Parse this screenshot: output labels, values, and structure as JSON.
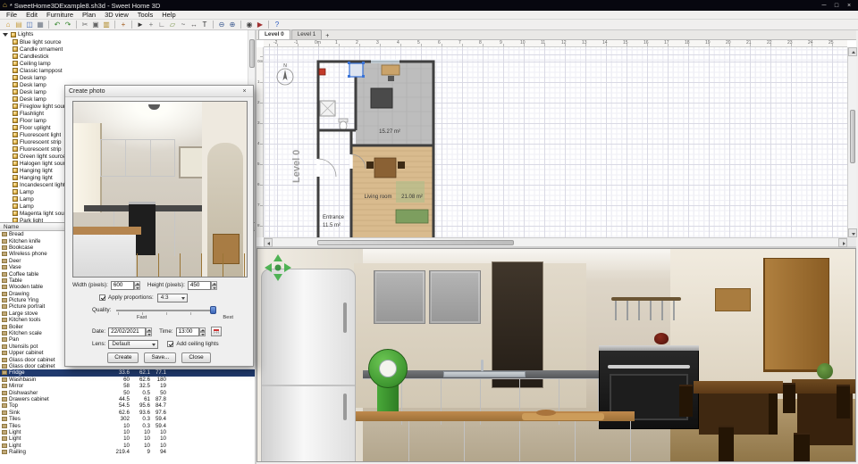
{
  "window": {
    "title": "* SweetHome3DExample8.sh3d - Sweet Home 3D",
    "app_icon": "⌂",
    "controls": {
      "minimize": "─",
      "maximize": "□",
      "close": "×"
    }
  },
  "menu": {
    "items": [
      "File",
      "Edit",
      "Furniture",
      "Plan",
      "3D view",
      "Tools",
      "Help"
    ]
  },
  "toolbar": {
    "buttons": [
      {
        "name": "new-home-icon",
        "glyph": "⌂",
        "color": "#c8912a"
      },
      {
        "name": "open-icon",
        "glyph": "▤",
        "color": "#c8a24a"
      },
      {
        "name": "save-icon",
        "glyph": "◫",
        "color": "#3c66b0"
      },
      {
        "name": "print-icon",
        "glyph": "▦",
        "color": "#6d7683"
      },
      {
        "sep": true
      },
      {
        "name": "undo-icon",
        "glyph": "↶",
        "color": "#3c8a34"
      },
      {
        "name": "redo-icon",
        "glyph": "↷",
        "color": "#3c8a34"
      },
      {
        "sep": true
      },
      {
        "name": "cut-icon",
        "glyph": "✂",
        "color": "#666"
      },
      {
        "name": "copy-icon",
        "glyph": "▣",
        "color": "#666"
      },
      {
        "name": "paste-icon",
        "glyph": "▥",
        "color": "#b08a28"
      },
      {
        "sep": true
      },
      {
        "name": "add-furniture-icon",
        "glyph": "+",
        "color": "#a05a1a"
      },
      {
        "sep": true
      },
      {
        "name": "select-icon",
        "glyph": "►",
        "color": "#333"
      },
      {
        "name": "pan-icon",
        "glyph": "+",
        "color": "#777"
      },
      {
        "name": "create-walls-icon",
        "glyph": "∟",
        "color": "#555"
      },
      {
        "name": "create-rooms-icon",
        "glyph": "▱",
        "color": "#6d8c3c"
      },
      {
        "name": "create-polylines-icon",
        "glyph": "~",
        "color": "#555"
      },
      {
        "name": "create-dimensions-icon",
        "glyph": "↔",
        "color": "#555"
      },
      {
        "name": "add-text-icon",
        "glyph": "T",
        "color": "#333"
      },
      {
        "sep": true
      },
      {
        "name": "zoom-out-icon",
        "glyph": "⊖",
        "color": "#3c5a90"
      },
      {
        "name": "zoom-in-icon",
        "glyph": "⊕",
        "color": "#3c5a90"
      },
      {
        "sep": true
      },
      {
        "name": "photo-icon",
        "glyph": "◉",
        "color": "#444"
      },
      {
        "name": "video-icon",
        "glyph": "▶",
        "color": "#a03030"
      },
      {
        "sep": true
      },
      {
        "name": "help-icon",
        "glyph": "?",
        "color": "#2a5ac0"
      }
    ]
  },
  "catalog": {
    "category": "Lights",
    "items": [
      "Blue light source",
      "Candle ornament",
      "Candlestick",
      "Ceiling lamp",
      "Classic lamppost",
      "Desk lamp",
      "Desk lamp",
      "Desk lamp",
      "Desk lamp",
      "Fireglow light sour",
      "Flashlight",
      "Floor lamp",
      "Floor uplight",
      "Fluorescent light",
      "Fluorescent strip",
      "Fluorescent strip",
      "Green light source",
      "Halogen light sour",
      "Hanging light",
      "Hanging light",
      "Incandescent light",
      "Lamp",
      "Lamp",
      "Lamp",
      "Magenta light sou",
      "Park light"
    ]
  },
  "furniture_list": {
    "header": "Name",
    "rows": [
      {
        "name": "Bread",
        "v1": "",
        "v2": "",
        "v3": ""
      },
      {
        "name": "Kitchen knife",
        "v1": "",
        "v2": "",
        "v3": ""
      },
      {
        "name": "Bookcase",
        "v1": "",
        "v2": "",
        "v3": ""
      },
      {
        "name": "Wireless phone",
        "v1": "",
        "v2": "",
        "v3": ""
      },
      {
        "name": "Deer",
        "v1": "",
        "v2": "",
        "v3": ""
      },
      {
        "name": "Vase",
        "v1": "",
        "v2": "",
        "v3": ""
      },
      {
        "name": "Coffee table",
        "v1": "",
        "v2": "",
        "v3": ""
      },
      {
        "name": "Table",
        "v1": "",
        "v2": "",
        "v3": ""
      },
      {
        "name": "Wooden table",
        "v1": "",
        "v2": "",
        "v3": ""
      },
      {
        "name": "Drawing",
        "v1": "",
        "v2": "",
        "v3": ""
      },
      {
        "name": "Picture Ying",
        "v1": "",
        "v2": "",
        "v3": ""
      },
      {
        "name": "Picture portrait",
        "v1": "",
        "v2": "",
        "v3": ""
      },
      {
        "name": "Large stove",
        "v1": "",
        "v2": "",
        "v3": ""
      },
      {
        "name": "Kitchen tools",
        "v1": "",
        "v2": "",
        "v3": ""
      },
      {
        "name": "Boiler",
        "v1": "",
        "v2": "",
        "v3": ""
      },
      {
        "name": "Kitchen scale",
        "v1": "",
        "v2": "",
        "v3": ""
      },
      {
        "name": "Pan",
        "v1": "",
        "v2": "",
        "v3": ""
      },
      {
        "name": "Utensils pot",
        "v1": "",
        "v2": "",
        "v3": ""
      },
      {
        "name": "Upper cabinet",
        "v1": "",
        "v2": "",
        "v3": ""
      },
      {
        "name": "Glass door cabinet",
        "v1": "",
        "v2": "",
        "v3": ""
      },
      {
        "name": "Glass door cabinet",
        "v1": "",
        "v2": "",
        "v3": ""
      },
      {
        "name": "Fridge",
        "v1": "33.6",
        "v2": "62.1",
        "v3": "77.1",
        "selected": true
      },
      {
        "name": "Washbasin",
        "v1": "60",
        "v2": "62.6",
        "v3": "180"
      },
      {
        "name": "Mirror",
        "v1": "58",
        "v2": "32.5",
        "v3": "19"
      },
      {
        "name": "Dishwasher",
        "v1": "50",
        "v2": "0.5",
        "v3": "50"
      },
      {
        "name": "Drawers cabinet",
        "v1": "44.5",
        "v2": "61",
        "v3": "87.8"
      },
      {
        "name": "Top",
        "v1": "54.5",
        "v2": "95.6",
        "v3": "84.7"
      },
      {
        "name": "Sink",
        "v1": "62.6",
        "v2": "93.6",
        "v3": "97.6"
      },
      {
        "name": "Tiles",
        "v1": "302",
        "v2": "0.3",
        "v3": "59.4"
      },
      {
        "name": "Tiles",
        "v1": "10",
        "v2": "0.3",
        "v3": "59.4"
      },
      {
        "name": "Light",
        "v1": "10",
        "v2": "10",
        "v3": "10"
      },
      {
        "name": "Light",
        "v1": "10",
        "v2": "10",
        "v3": "10"
      },
      {
        "name": "Light",
        "v1": "10",
        "v2": "10",
        "v3": "10"
      },
      {
        "name": "Railing",
        "v1": "219.4",
        "v2": "9",
        "v3": "94"
      }
    ]
  },
  "plan": {
    "tabs": [
      {
        "label": "Level 0"
      },
      {
        "label": "Level 1"
      }
    ],
    "add_tab": "+",
    "ruler_top": [
      "-2",
      "-1",
      "0m",
      "1",
      "2",
      "3",
      "4",
      "5",
      "6",
      "7",
      "8",
      "9",
      "10",
      "11",
      "12",
      "13",
      "14",
      "15",
      "16",
      "17",
      "18",
      "19",
      "20",
      "21",
      "22",
      "23",
      "24",
      "25"
    ],
    "ruler_left": [
      "0m",
      "1",
      "2",
      "3",
      "4",
      "5",
      "6",
      "7",
      "8"
    ],
    "compass_label": "N",
    "level_watermark": "Level 0",
    "rooms": [
      {
        "name": "",
        "area": "15.27 m²"
      },
      {
        "name": "Living room",
        "area": "21.08 m²"
      },
      {
        "name": "Entrance",
        "area": "11.5 m²"
      }
    ]
  },
  "dialog": {
    "title": "Create photo",
    "close_x": "×",
    "width_label": "Width (pixels):",
    "width_value": "600",
    "height_label": "Height (pixels):",
    "height_value": "450",
    "proportions_label": "Apply proportions:",
    "proportions_value": "4:3",
    "quality_label": "Quality:",
    "quality_fast": "Fast",
    "quality_best": "Best",
    "date_label": "Date:",
    "date_value": "22/02/2021",
    "time_label": "Time:",
    "time_value": "13:00",
    "lens_label": "Lens:",
    "lens_value": "Default",
    "ceiling_lights_label": "Add ceiling lights",
    "buttons": {
      "create": "Create",
      "save": "Save...",
      "close": "Close"
    }
  }
}
